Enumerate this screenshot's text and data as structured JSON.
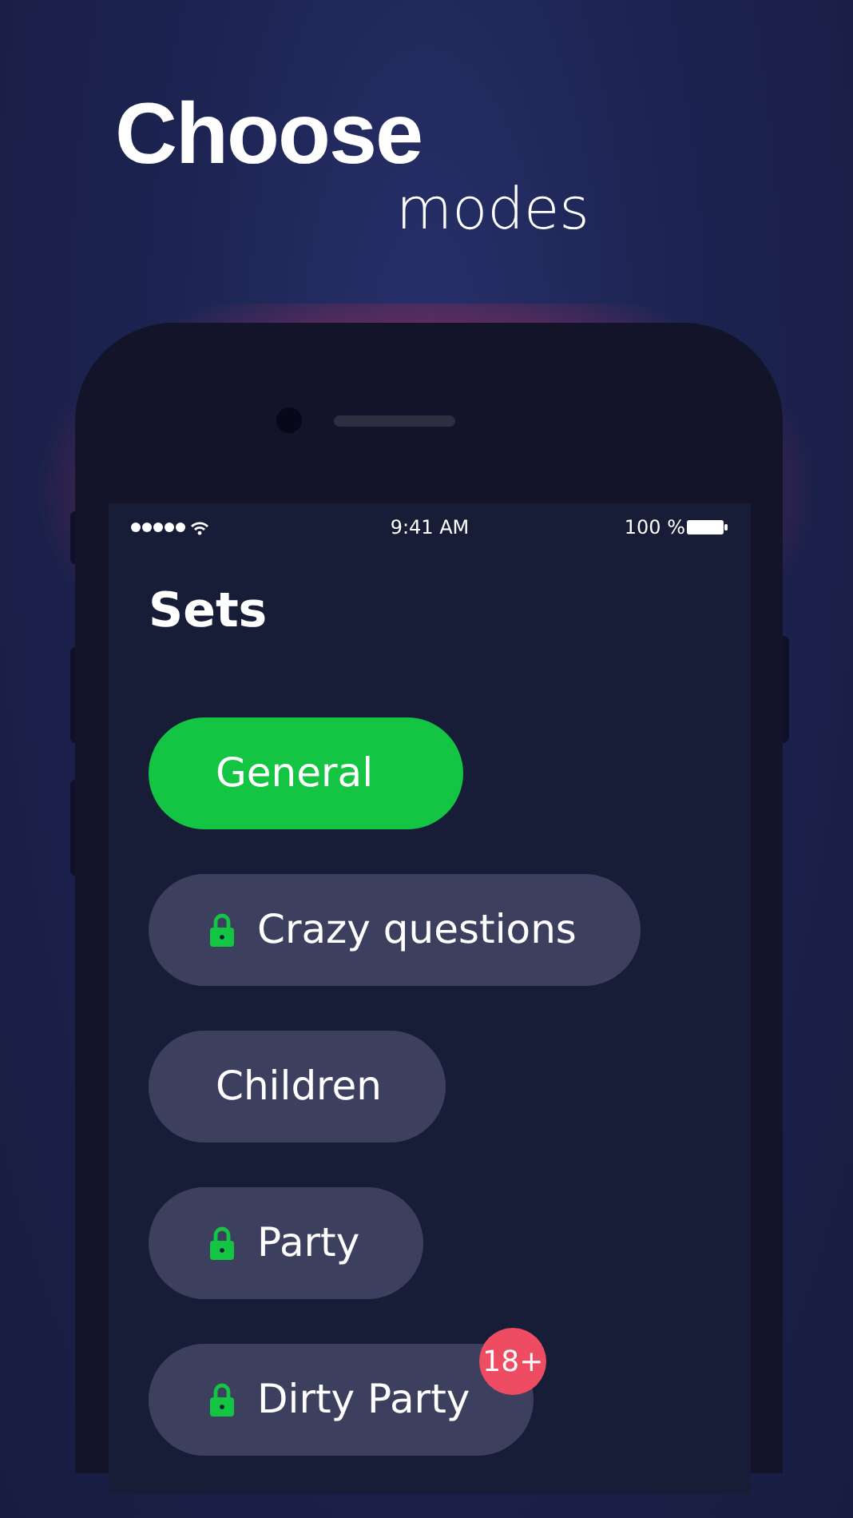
{
  "headline": {
    "title": "Choose",
    "subtitle": "modes"
  },
  "status_bar": {
    "time": "9:41 AM",
    "battery": "100 %"
  },
  "screen": {
    "title": "Sets",
    "sets": [
      {
        "label": "General",
        "selected": true,
        "locked": false
      },
      {
        "label": "Crazy questions",
        "selected": false,
        "locked": true
      },
      {
        "label": "Children",
        "selected": false,
        "locked": false
      },
      {
        "label": "Party",
        "selected": false,
        "locked": true
      },
      {
        "label": "Dirty Party",
        "selected": false,
        "locked": true,
        "badge": "18+"
      }
    ]
  }
}
